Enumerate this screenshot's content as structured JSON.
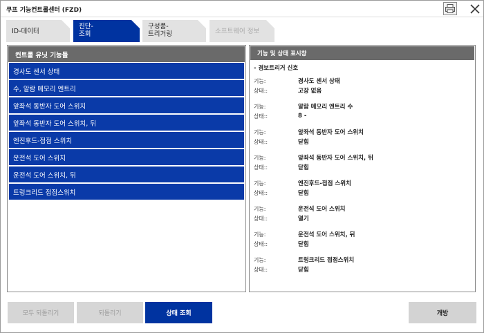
{
  "window": {
    "title": "쿠프 기능컨트롤센터 (FZD)"
  },
  "tabs": [
    {
      "label": "ID-데이터"
    },
    {
      "label_line1": "진단-",
      "label_line2": "조회"
    },
    {
      "label_line1": "구성품-",
      "label_line2": "트리거링"
    },
    {
      "label": "소프트웨어 정보"
    }
  ],
  "left_panel": {
    "header": "컨트롤 유닛 기능들",
    "items": [
      "경사도 센서 상태",
      "수, 알람 메모리 엔트리",
      "앞좌석 동반자 도어 스위치",
      "앞좌석 동반자 도어 스위치, 뒤",
      "엔진후드-접점 스위치",
      "운전석 도어 스위치",
      "운전석 도어 스위치, 뒤",
      "트렁크리드 접점스위치"
    ]
  },
  "right_panel": {
    "header": "기능 및 상태 표시창",
    "group_title": "- 경보트리거 신호",
    "function_label": "기능:",
    "status_label": "상태::",
    "entries": [
      {
        "function": "경사도 센서 상태",
        "status": "고장 없음"
      },
      {
        "function": "알람 메모리 엔트리 수",
        "status": "8 -"
      },
      {
        "function": "앞좌석 동반자 도어 스위치",
        "status": "닫힘"
      },
      {
        "function": "앞좌석 동반자 도어 스위치, 뒤",
        "status": "닫힘"
      },
      {
        "function": "엔진후드-접점 스위치",
        "status": "닫힘"
      },
      {
        "function": "운전석 도어 스위치",
        "status": "열기"
      },
      {
        "function": "운전석 도어 스위치, 뒤",
        "status": "닫힘"
      },
      {
        "function": "트렁크리드 접점스위치",
        "status": "닫힘"
      }
    ]
  },
  "buttons": {
    "reset_all": "모두 되돌리기",
    "reset": "되돌리기",
    "status_query": "상태 조회",
    "open": "개방"
  },
  "colors": {
    "accent": "#0033a0",
    "list_item": "#0a3aa8",
    "header": "#6a6a6a"
  }
}
